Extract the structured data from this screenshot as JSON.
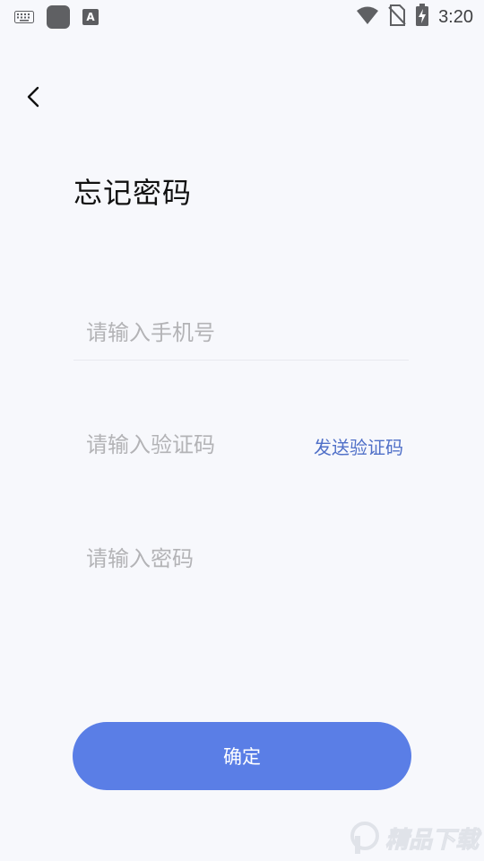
{
  "status_bar": {
    "time": "3:20",
    "icons": [
      "keyboard-icon",
      "app-icon",
      "font-icon",
      "wifi-icon",
      "no-sim-icon",
      "battery-charging-icon"
    ],
    "font_icon_label": "A"
  },
  "nav": {
    "back_icon": "chevron-left-icon"
  },
  "page": {
    "title": "忘记密码"
  },
  "form": {
    "phone": {
      "placeholder": "请输入手机号",
      "value": ""
    },
    "code": {
      "placeholder": "请输入验证码",
      "value": "",
      "send_label": "发送验证码"
    },
    "password": {
      "placeholder": "请输入密码",
      "value": ""
    }
  },
  "actions": {
    "confirm_label": "确定"
  },
  "colors": {
    "background": "#f7f8fc",
    "accent": "#5a7ee6",
    "link": "#5070c8",
    "placeholder": "#b3b3b6"
  },
  "watermark": {
    "text": "精品下载"
  }
}
